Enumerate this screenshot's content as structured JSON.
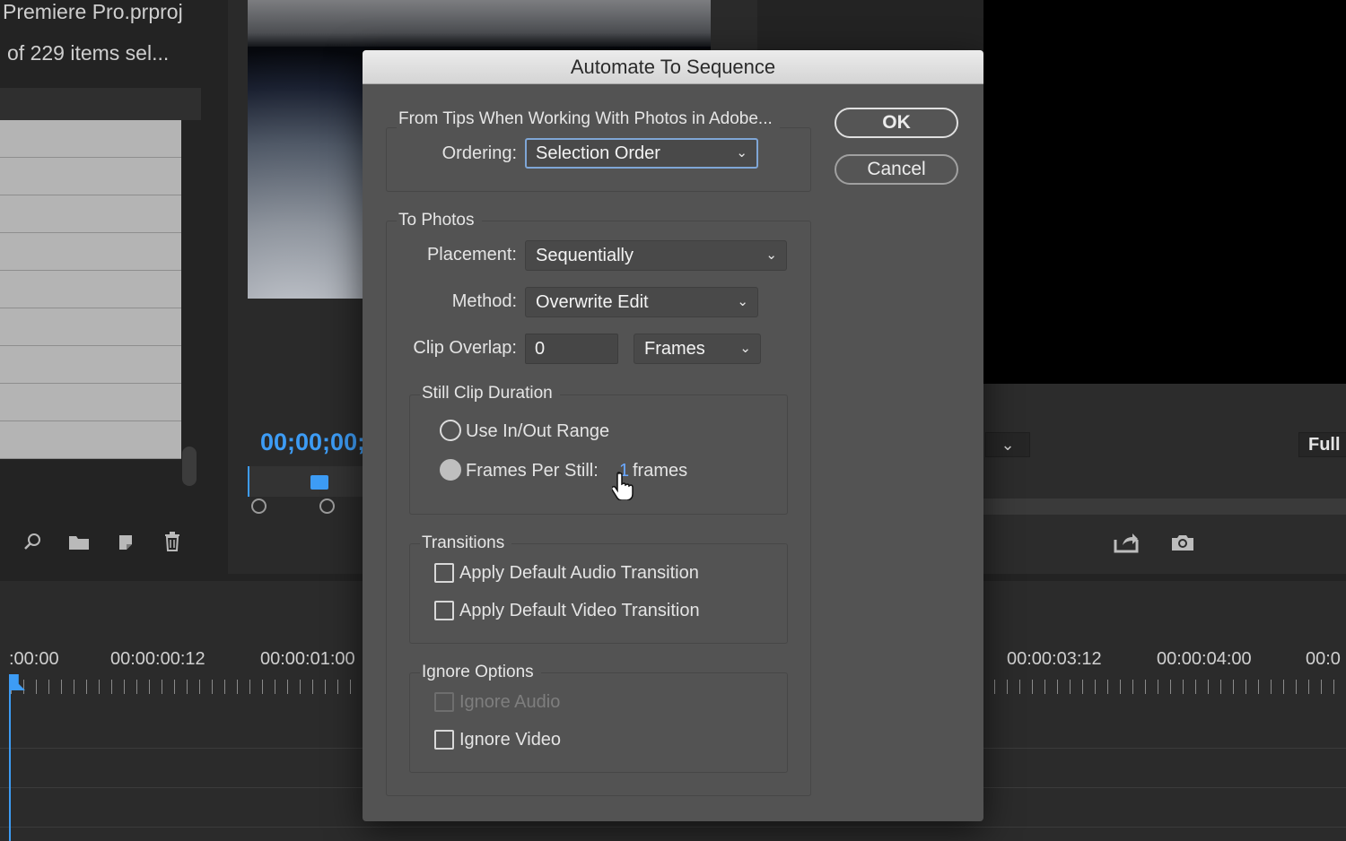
{
  "project": {
    "title": "Premiere Pro.prproj",
    "items_selected": "of 229 items sel..."
  },
  "source_monitor": {
    "timecode": "00;00;00;"
  },
  "program_monitor": {
    "zoom_dropdown": "⌄",
    "resolution": "Full"
  },
  "timeline": {
    "timecodes": [
      ":00:00",
      "00:00:00:12",
      "00:00:01:00",
      "00:00:03:12",
      "00:00:04:00",
      "00:0"
    ]
  },
  "dialog": {
    "title": "Automate To Sequence",
    "from_label": "From Tips When Working With Photos in Adobe...",
    "ordering_label": "Ordering:",
    "ordering_value": "Selection Order",
    "to_label": "To Photos",
    "placement_label": "Placement:",
    "placement_value": "Sequentially",
    "method_label": "Method:",
    "method_value": "Overwrite Edit",
    "overlap_label": "Clip Overlap:",
    "overlap_value": "0",
    "overlap_unit": "Frames",
    "still_clip": {
      "legend": "Still Clip Duration",
      "use_inout": "Use In/Out Range",
      "frames_per_still": "Frames Per Still:",
      "frames_value": "1",
      "frames_unit": "frames"
    },
    "transitions": {
      "legend": "Transitions",
      "audio": "Apply Default Audio Transition",
      "video": "Apply Default Video Transition"
    },
    "ignore": {
      "legend": "Ignore Options",
      "audio": "Ignore Audio",
      "video": "Ignore Video"
    },
    "ok": "OK",
    "cancel": "Cancel"
  },
  "colors": {
    "accent_blue": "#3d9cf5",
    "dialog_bg": "#535353",
    "focus_ring": "#7fa6d6"
  }
}
